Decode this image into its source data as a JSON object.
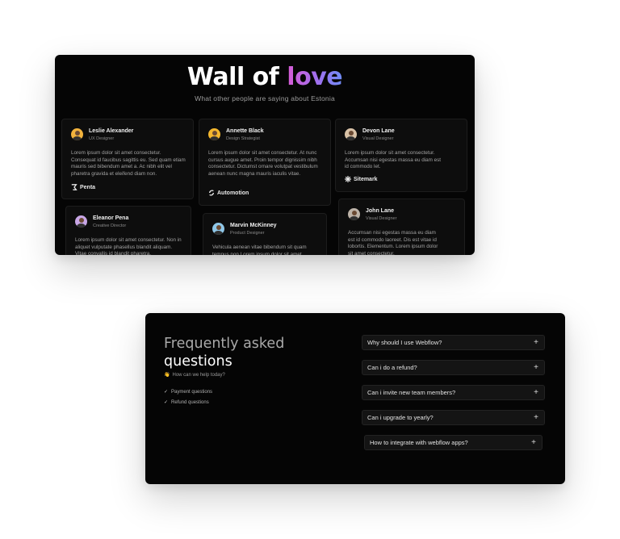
{
  "wall": {
    "title_main": "Wall of ",
    "title_accent": "love",
    "subtitle": "What other people are saying about Estonia",
    "testimonials": [
      {
        "name": "Leslie Alexander",
        "role": "UX Designer",
        "text": "Lorem ipsum dolor sit amet consectetur. Consequat id faucibus sagittis eu. Sed quam etiam mauris sed bibendum amet a. Ac nibh elit vel pharetra gravida et eleifend diam non.",
        "company": "Penta",
        "avatar_color": "#f2b33d"
      },
      {
        "name": "Annette Black",
        "role": "Design Strategist",
        "text": "Lorem ipsum dolor sit amet consectetur. At nunc cursus augue amet. Proin tempor dignissim nibh consectetur. Dictumst ornare volutpat vestibulum aenean nunc magna mauris iaculis vitae.",
        "company": "Automotion",
        "avatar_color": "#f4b72e"
      },
      {
        "name": "Devon Lane",
        "role": "Visual Designer",
        "text": "Lorem ipsum dolor sit amet consectetur. Accumsan nisi egestas massa eu diam est id commodo let.",
        "company": "Sitemark",
        "avatar_color": "#d9c2a7"
      },
      {
        "name": "Eleanor Pena",
        "role": "Creative Director",
        "text": "Lorem ipsum dolor sit amet consectetur. Non in aliquet vulputate phasellus blandit aliquam. Vitae convallis id blandit pharetra.",
        "company": "",
        "avatar_color": "#c8a6e6"
      },
      {
        "name": "Marvin McKinney",
        "role": "Product Designer",
        "text": "Vehicula aenean vitae bibendum sit quam tempus non.Lorem ipsum dolor sit amet",
        "company": "",
        "avatar_color": "#8fc7e8"
      },
      {
        "name": "John Lane",
        "role": "Visual Designer",
        "text": "Accumsan nisi egestas massa eu diam est id commodo laoreet. Dis est vitae id lobortis. Elementum. Lorem ipsum dolor sit amet consectetur.",
        "company": "",
        "avatar_color": "#bdb3a8"
      }
    ]
  },
  "faq": {
    "title_line1": "Frequently asked",
    "title_line2": "questions",
    "help_emoji": "👋",
    "help_text": "How can we help today?",
    "categories": [
      "Payment questions",
      "Refund questions"
    ],
    "questions": [
      "Why should I use Webflow?",
      "Can i do a refund?",
      "Can i invite new team members?",
      "Can i upgrade to yearly?",
      "How to integrate with webflow apps?"
    ],
    "expand_icon": "+"
  }
}
